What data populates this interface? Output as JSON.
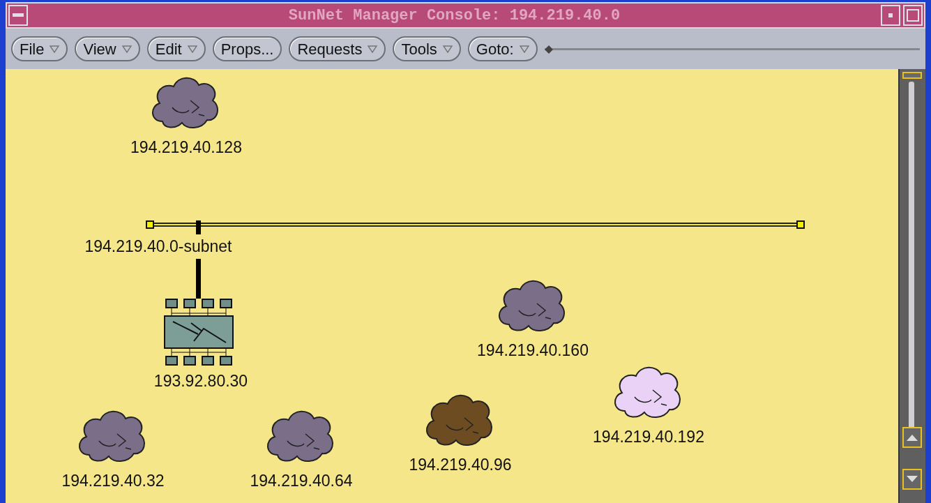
{
  "window": {
    "title": "SunNet Manager Console: 194.219.40.0"
  },
  "toolbar": [
    {
      "label": "File",
      "has_menu": true
    },
    {
      "label": "View",
      "has_menu": true
    },
    {
      "label": "Edit",
      "has_menu": true
    },
    {
      "label": "Props...",
      "has_menu": false
    },
    {
      "label": "Requests",
      "has_menu": true
    },
    {
      "label": "Tools",
      "has_menu": true
    },
    {
      "label": "Goto:",
      "has_menu": true
    }
  ],
  "zoom_slider": {
    "level": 0
  },
  "map": {
    "nodes": [
      {
        "kind": "cloud",
        "label": "194.219.40.128",
        "color": "#7a6e88"
      },
      {
        "kind": "bus",
        "label": "194.219.40.0-subnet"
      },
      {
        "kind": "router",
        "label": "193.92.80.30"
      },
      {
        "kind": "cloud",
        "label": "194.219.40.160",
        "color": "#7a6e88"
      },
      {
        "kind": "cloud",
        "label": "194.219.40.192",
        "color": "#ead2f6"
      },
      {
        "kind": "cloud",
        "label": "194.219.40.32",
        "color": "#7a6e88"
      },
      {
        "kind": "cloud",
        "label": "194.219.40.64",
        "color": "#7a6e88"
      },
      {
        "kind": "cloud",
        "label": "194.219.40.96",
        "color": "#6e4c22"
      }
    ]
  }
}
